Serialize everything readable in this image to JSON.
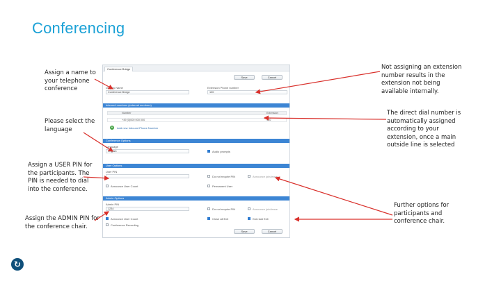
{
  "slide": {
    "title": "Conferencing"
  },
  "callouts": {
    "assign_name": "Assign a name to your telephone conference",
    "select_language": "Please select the language",
    "user_pin": "Assign a USER PIN for the participants. The PIN is needed to dial into the conference.",
    "admin_pin": "Assign the ADMIN PIN for the conference chair.",
    "no_extension": "Not assigning an extension number results in the extension not being available internally.",
    "direct_dial": "The direct dial number is automatically assigned according to your extension, once a main outside line is selected",
    "further_options": "Further options for participants and conference chair."
  },
  "screenshot": {
    "tab": "Conference Bridge",
    "save": "Save",
    "cancel": "Cancel",
    "display_name_label": "Display Name",
    "display_name_value": "Conference Bridge",
    "ext_label": "Extension Phone number",
    "ext_value": "100",
    "inbound_section": "Inbound numbers (external numbers)",
    "col_number": "Number",
    "col_extension": "Extension",
    "row_number": "+49 (0)000 000 000",
    "row_extension": "100",
    "add_number": "Add new Inbound Phone Number",
    "conference_options": "Conference Options",
    "language_label": "Language",
    "language_value": "English",
    "audio_prompts": "Audio prompts",
    "user_options": "User Options",
    "user_pin_label": "User PIN",
    "user_pin_value": "",
    "user_opt_1": "Do not require PIN",
    "user_opt_2": "Announce User Count",
    "user_opt_3": "Permanent User",
    "user_opt_4": "Announce join/leave",
    "admin_options": "Admin Options",
    "admin_pin_label": "Admin PIN",
    "admin_pin_value": "1234",
    "admin_opt_1": "Do not require PIN",
    "admin_opt_2": "Announce User Count",
    "admin_opt_3": "Close all Exit",
    "admin_opt_4": "Kick last Exit",
    "admin_opt_5": "Announce join/leave",
    "admin_opt_6": "Conference Recording"
  }
}
